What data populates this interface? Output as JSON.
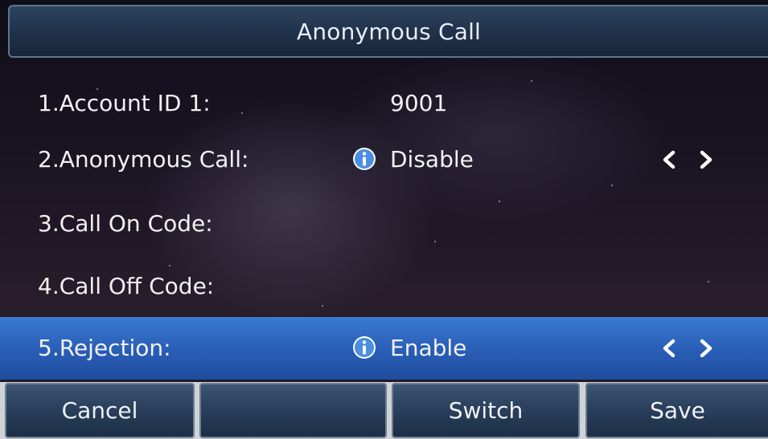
{
  "header": {
    "title": "Anonymous Call"
  },
  "rows": [
    {
      "label": "1.Account ID 1:",
      "value": "9001",
      "has_info": false,
      "has_arrows": false,
      "selected": false
    },
    {
      "label": "2.Anonymous Call:",
      "value": "Disable",
      "has_info": true,
      "has_arrows": true,
      "selected": false
    },
    {
      "label": "3.Call On Code:",
      "value": "",
      "has_info": false,
      "has_arrows": false,
      "selected": false
    },
    {
      "label": "4.Call Off Code:",
      "value": "",
      "has_info": false,
      "has_arrows": false,
      "selected": false
    },
    {
      "label": "5.Rejection:",
      "value": "Enable",
      "has_info": true,
      "has_arrows": true,
      "selected": true
    }
  ],
  "softkeys": [
    {
      "label": "Cancel"
    },
    {
      "label": ""
    },
    {
      "label": "Switch"
    },
    {
      "label": "Save"
    }
  ],
  "icons": {
    "info": "info-icon",
    "prev": "chevron-left-icon",
    "next": "chevron-right-icon"
  },
  "colors": {
    "selection": "#2a5fb8",
    "title_bar": "#22344d",
    "info_icon": "#4a8fe0",
    "text": "#f1f1f1"
  }
}
